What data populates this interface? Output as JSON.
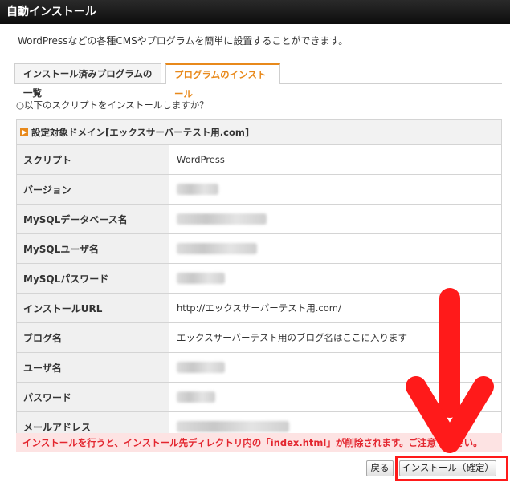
{
  "window": {
    "title": "自動インストール"
  },
  "description": "WordPressなどの各種CMSやプログラムを簡単に設置することができます。",
  "tabs": [
    {
      "label": "インストール済みプログラムの一覧",
      "active": false
    },
    {
      "label": "プログラムのインストール",
      "active": true
    }
  ],
  "question": "○以下のスクリプトをインストールしますか？",
  "section_header": "設定対象ドメイン[エックスサーバーテスト用.com]",
  "rows": [
    {
      "label": "スクリプト",
      "value": "WordPress"
    },
    {
      "label": "バージョン",
      "value": ""
    },
    {
      "label": "MySQLデータベース名",
      "value": ""
    },
    {
      "label": "MySQLユーザ名",
      "value": ""
    },
    {
      "label": "MySQLパスワード",
      "value": ""
    },
    {
      "label": "インストールURL",
      "value": "http://エックスサーバーテスト用.com/"
    },
    {
      "label": "ブログ名",
      "value": "エックスサーバーテスト用のブログ名はここに入ります"
    },
    {
      "label": "ユーザ名",
      "value": ""
    },
    {
      "label": "パスワード",
      "value": ""
    },
    {
      "label": "メールアドレス",
      "value": ""
    }
  ],
  "warning": "インストールを行うと、インストール先ディレクトリ内の「index.html」が削除されます。ご注意ください。",
  "buttons": {
    "back": "戻る",
    "confirm": "インストール（確定）"
  },
  "colors": {
    "accent": "#e8891b",
    "warning_text": "#e3262f",
    "warning_bg": "#fde3e3",
    "annotation": "#ff1a1a"
  },
  "icons": {
    "section_marker": "play-bullet-icon",
    "annotation_arrow": "down-arrow-icon"
  }
}
